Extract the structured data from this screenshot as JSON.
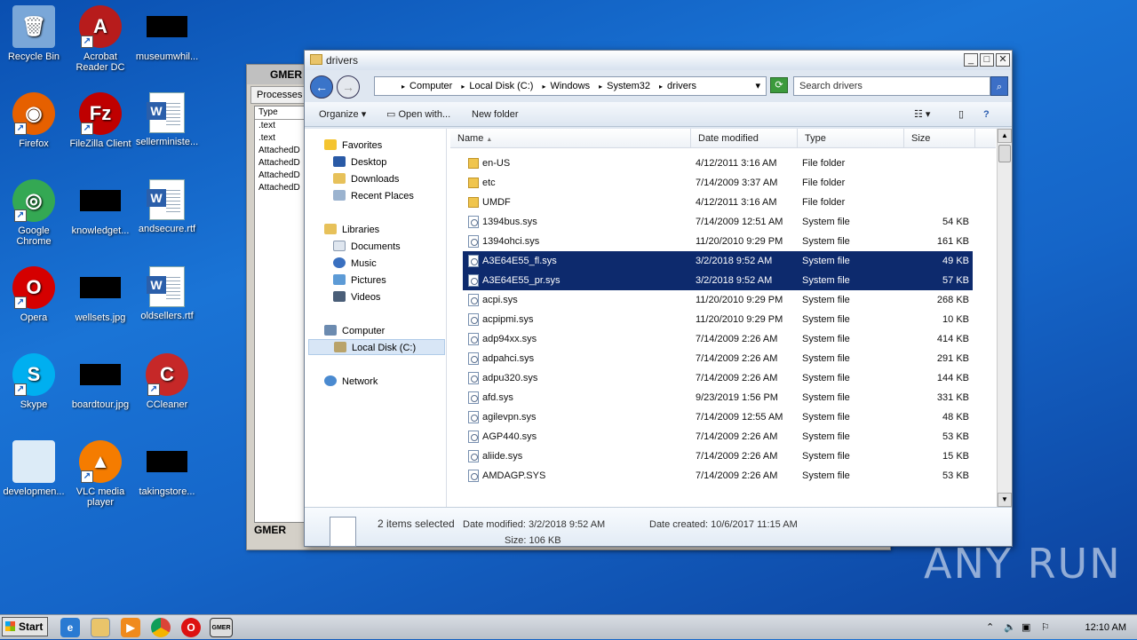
{
  "desktop": {
    "icons": [
      {
        "label": "Recycle Bin",
        "icon": "recycle-bin-icon"
      },
      {
        "label": "Acrobat Reader DC",
        "icon": "acrobat-icon"
      },
      {
        "label": "museumwhil...",
        "icon": "redacted-file-icon"
      },
      {
        "label": "Firefox",
        "icon": "firefox-icon"
      },
      {
        "label": "FileZilla Client",
        "icon": "filezilla-icon"
      },
      {
        "label": "sellerministe...",
        "icon": "word-doc-icon"
      },
      {
        "label": "Google Chrome",
        "icon": "chrome-icon"
      },
      {
        "label": "knowledget...",
        "icon": "redacted-file-icon"
      },
      {
        "label": "andsecure.rtf",
        "icon": "word-doc-icon"
      },
      {
        "label": "Opera",
        "icon": "opera-icon"
      },
      {
        "label": "wellsets.jpg",
        "icon": "redacted-file-icon"
      },
      {
        "label": "oldsellers.rtf",
        "icon": "word-doc-icon"
      },
      {
        "label": "Skype",
        "icon": "skype-icon"
      },
      {
        "label": "boardtour.jpg",
        "icon": "redacted-file-icon"
      },
      {
        "label": "CCleaner",
        "icon": "ccleaner-icon"
      },
      {
        "label": "developmen...",
        "icon": "file-icon"
      },
      {
        "label": "VLC media player",
        "icon": "vlc-icon"
      },
      {
        "label": "takingstore...",
        "icon": "redacted-file-icon"
      }
    ]
  },
  "gmer": {
    "title": "GMER",
    "tab": "Processes",
    "column": "Type",
    "rows": [
      ".text",
      ".text",
      "AttachedD",
      "AttachedD",
      "AttachedD",
      "AttachedD"
    ],
    "footer": "GMER"
  },
  "explorer": {
    "title": "drivers",
    "breadcrumbs": [
      "Computer",
      "Local Disk (C:)",
      "Windows",
      "System32",
      "drivers"
    ],
    "search_placeholder": "Search drivers",
    "toolbar": {
      "organize": "Organize",
      "open_with": "Open with...",
      "new_folder": "New folder"
    },
    "nav": {
      "favorites": "Favorites",
      "desktop": "Desktop",
      "downloads": "Downloads",
      "recent": "Recent Places",
      "libraries": "Libraries",
      "documents": "Documents",
      "music": "Music",
      "pictures": "Pictures",
      "videos": "Videos",
      "computer": "Computer",
      "local_disk": "Local Disk (C:)",
      "network": "Network"
    },
    "columns": {
      "name": "Name",
      "date": "Date modified",
      "type": "Type",
      "size": "Size"
    },
    "files": [
      {
        "name": "en-US",
        "date": "4/12/2011 3:16 AM",
        "type": "File folder",
        "size": "",
        "kind": "folder"
      },
      {
        "name": "etc",
        "date": "7/14/2009 3:37 AM",
        "type": "File folder",
        "size": "",
        "kind": "folder"
      },
      {
        "name": "UMDF",
        "date": "4/12/2011 3:16 AM",
        "type": "File folder",
        "size": "",
        "kind": "folder"
      },
      {
        "name": "1394bus.sys",
        "date": "7/14/2009 12:51 AM",
        "type": "System file",
        "size": "54 KB",
        "kind": "sys"
      },
      {
        "name": "1394ohci.sys",
        "date": "11/20/2010 9:29 PM",
        "type": "System file",
        "size": "161 KB",
        "kind": "sys"
      },
      {
        "name": "A3E64E55_fl.sys",
        "date": "3/2/2018 9:52 AM",
        "type": "System file",
        "size": "49 KB",
        "kind": "sys",
        "selected": true
      },
      {
        "name": "A3E64E55_pr.sys",
        "date": "3/2/2018 9:52 AM",
        "type": "System file",
        "size": "57 KB",
        "kind": "sys",
        "selected": true
      },
      {
        "name": "acpi.sys",
        "date": "11/20/2010 9:29 PM",
        "type": "System file",
        "size": "268 KB",
        "kind": "sys"
      },
      {
        "name": "acpipmi.sys",
        "date": "11/20/2010 9:29 PM",
        "type": "System file",
        "size": "10 KB",
        "kind": "sys"
      },
      {
        "name": "adp94xx.sys",
        "date": "7/14/2009 2:26 AM",
        "type": "System file",
        "size": "414 KB",
        "kind": "sys"
      },
      {
        "name": "adpahci.sys",
        "date": "7/14/2009 2:26 AM",
        "type": "System file",
        "size": "291 KB",
        "kind": "sys"
      },
      {
        "name": "adpu320.sys",
        "date": "7/14/2009 2:26 AM",
        "type": "System file",
        "size": "144 KB",
        "kind": "sys"
      },
      {
        "name": "afd.sys",
        "date": "9/23/2019 1:56 PM",
        "type": "System file",
        "size": "331 KB",
        "kind": "sys"
      },
      {
        "name": "agilevpn.sys",
        "date": "7/14/2009 12:55 AM",
        "type": "System file",
        "size": "48 KB",
        "kind": "sys"
      },
      {
        "name": "AGP440.sys",
        "date": "7/14/2009 2:26 AM",
        "type": "System file",
        "size": "53 KB",
        "kind": "sys"
      },
      {
        "name": "aliide.sys",
        "date": "7/14/2009 2:26 AM",
        "type": "System file",
        "size": "15 KB",
        "kind": "sys"
      },
      {
        "name": "AMDAGP.SYS",
        "date": "7/14/2009 2:26 AM",
        "type": "System file",
        "size": "53 KB",
        "kind": "sys"
      }
    ],
    "details": {
      "selection": "2 items selected",
      "date_modified": "Date modified: 3/2/2018 9:52 AM",
      "date_created": "Date created: 10/6/2017 11:15 AM",
      "size": "Size: 106 KB"
    }
  },
  "taskbar": {
    "start": "Start",
    "clock": "12:10 AM"
  },
  "watermark": "ANY RUN"
}
